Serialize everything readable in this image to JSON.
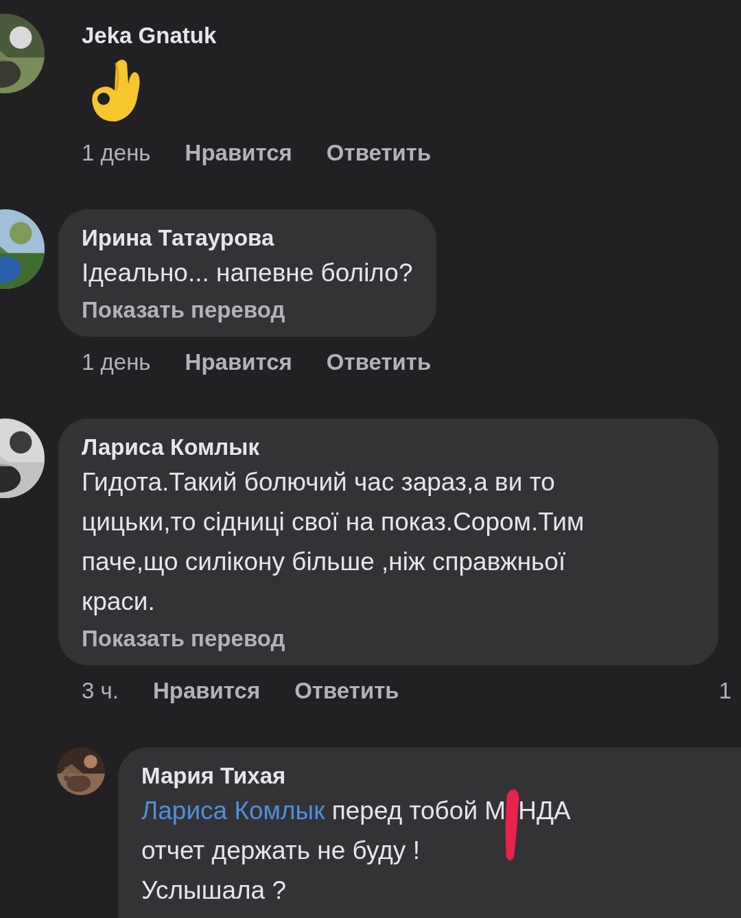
{
  "comments": [
    {
      "author": "Jeka Gnatuk",
      "kind": "emoji",
      "bubble": false,
      "avatar": {
        "kind": "picture"
      },
      "meta": {
        "time": "1 день",
        "like": "Нравится",
        "reply": "Ответить"
      }
    },
    {
      "author": "Ирина Татаурова",
      "kind": "text",
      "bubble": true,
      "avatar": {
        "kind": "picture"
      },
      "lines": [
        "Ідеально... напевне боліло?"
      ],
      "translate": "Показать перевод",
      "meta": {
        "time": "1 день",
        "like": "Нравится",
        "reply": "Ответить"
      }
    },
    {
      "author": "Лариса Комлык",
      "kind": "text",
      "bubble": true,
      "avatar": {
        "kind": "picture"
      },
      "lines": [
        "Гидота.Такий болючий час зараз,а ви то",
        "цицьки,то сідниці свої на показ.Сором.Тим",
        "паче,що силікону більше ,ніж справжньої",
        "краси."
      ],
      "translate": "Показать перевод",
      "meta": {
        "time": "3 ч.",
        "like": "Нравится",
        "reply": "Ответить",
        "replies_count": "1"
      },
      "replies": [
        {
          "author": "Мария Тихая",
          "avatar": {
            "kind": "picture"
          },
          "mention": "Лариса Комлык",
          "before_mark": "перед тобой М",
          "after_mark": "НДА",
          "lines": [
            "отчет держать не буду !",
            "Услышала ?"
          ]
        }
      ]
    }
  ]
}
